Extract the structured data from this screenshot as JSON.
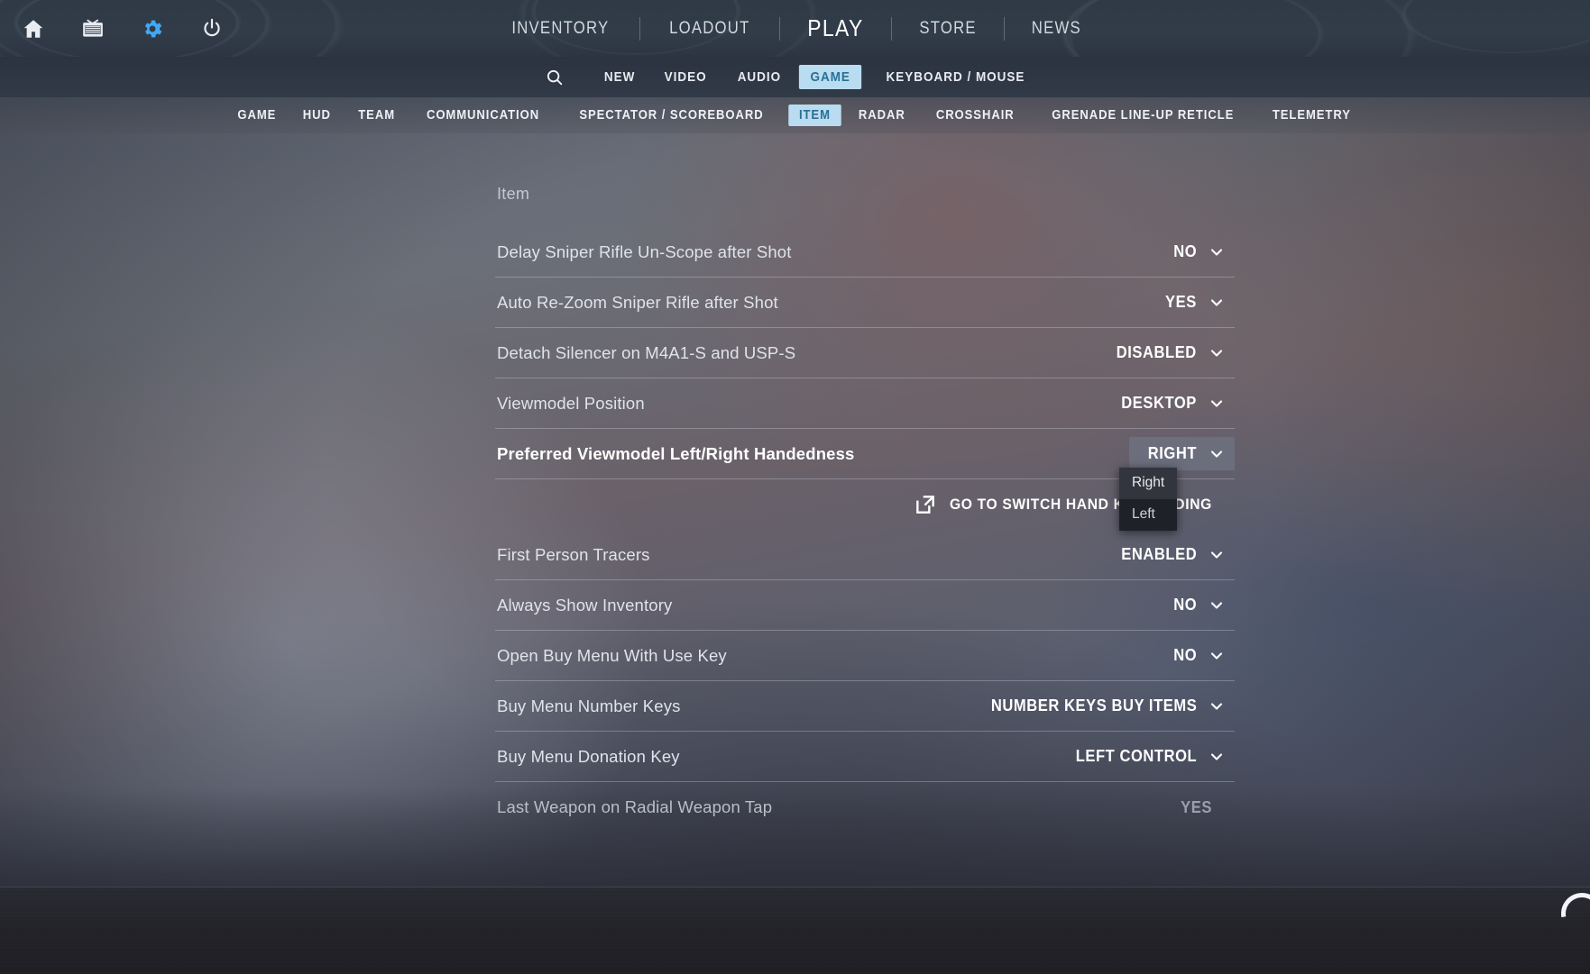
{
  "header": {
    "icons": [
      {
        "name": "home-icon",
        "label": "Home"
      },
      {
        "name": "tv-icon",
        "label": "Watch"
      },
      {
        "name": "gear-icon",
        "label": "Settings"
      },
      {
        "name": "power-icon",
        "label": "Quit"
      }
    ],
    "nav": [
      {
        "label": "INVENTORY",
        "active": false
      },
      {
        "label": "LOADOUT",
        "active": false
      },
      {
        "label": "PLAY",
        "active": true
      },
      {
        "label": "STORE",
        "active": false
      },
      {
        "label": "NEWS",
        "active": false
      }
    ]
  },
  "subnav": {
    "search_icon": "search-icon",
    "items": [
      {
        "label": "NEW",
        "active": false
      },
      {
        "label": "VIDEO",
        "active": false
      },
      {
        "label": "AUDIO",
        "active": false
      },
      {
        "label": "GAME",
        "active": true
      },
      {
        "label": "KEYBOARD / MOUSE",
        "active": false
      }
    ]
  },
  "tabnav": {
    "items": [
      {
        "label": "GAME",
        "active": false
      },
      {
        "label": "HUD",
        "active": false
      },
      {
        "label": "TEAM",
        "active": false
      },
      {
        "label": "COMMUNICATION",
        "active": false
      },
      {
        "label": "SPECTATOR / SCOREBOARD",
        "active": false
      },
      {
        "label": "ITEM",
        "active": true
      },
      {
        "label": "RADAR",
        "active": false
      },
      {
        "label": "CROSSHAIR",
        "active": false
      },
      {
        "label": "GRENADE LINE-UP RETICLE",
        "active": false
      },
      {
        "label": "TELEMETRY",
        "active": false
      }
    ]
  },
  "panel": {
    "title": "Item",
    "rows": [
      {
        "label": "Delay Sniper Rifle Un-Scope after Shot",
        "value": "NO",
        "type": "dropdown",
        "state": "normal"
      },
      {
        "label": "Auto Re-Zoom Sniper Rifle after Shot",
        "value": "YES",
        "type": "dropdown",
        "state": "normal"
      },
      {
        "label": "Detach Silencer on M4A1-S and USP-S",
        "value": "DISABLED",
        "type": "dropdown",
        "state": "normal"
      },
      {
        "label": "Viewmodel Position",
        "value": "DESKTOP",
        "type": "dropdown",
        "state": "normal"
      },
      {
        "label": "Preferred Viewmodel Left/Right Handedness",
        "value": "RIGHT",
        "type": "dropdown",
        "state": "hot"
      },
      {
        "label": "",
        "value": "GO TO SWITCH HAND KEY BINDING",
        "type": "link",
        "state": "normal",
        "icon": "external-link-icon"
      },
      {
        "label": "First Person Tracers",
        "value": "ENABLED",
        "type": "dropdown",
        "state": "normal"
      },
      {
        "label": "Always Show Inventory",
        "value": "NO",
        "type": "dropdown",
        "state": "normal"
      },
      {
        "label": "Open Buy Menu With Use Key",
        "value": "NO",
        "type": "dropdown",
        "state": "normal"
      },
      {
        "label": "Buy Menu Number Keys",
        "value": "NUMBER KEYS BUY ITEMS",
        "type": "dropdown",
        "state": "normal"
      },
      {
        "label": "Buy Menu Donation Key",
        "value": "LEFT CONTROL",
        "type": "dropdown",
        "state": "normal"
      },
      {
        "label": "Last Weapon on Radial Weapon Tap",
        "value": "YES",
        "type": "text",
        "state": "disabled"
      }
    ]
  },
  "dropdown": {
    "open": true,
    "owner": "Preferred Viewmodel Left/Right Handedness",
    "options": [
      {
        "label": "Right",
        "selected": true
      },
      {
        "label": "Left",
        "selected": false
      }
    ]
  },
  "colors": {
    "accent": "#b9dcf0",
    "accent_text": "#2a6f95",
    "gear_icon": "#3fa9f5",
    "panel_text": "#dfe3ea",
    "divider": "rgba(225,230,238,0.30)",
    "dropdown_bg": "#1f2128"
  }
}
